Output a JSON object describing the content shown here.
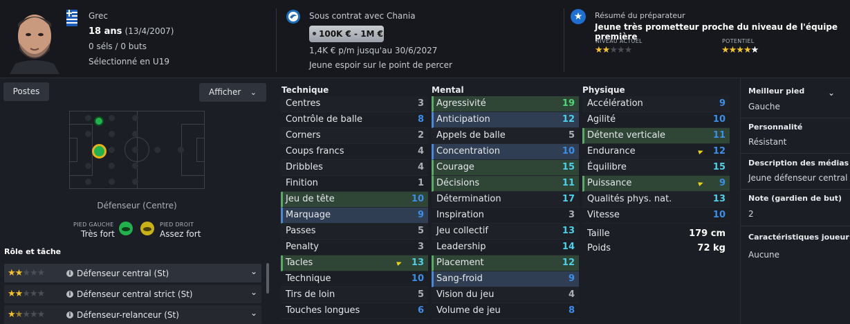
{
  "header": {
    "nationality": "Grec",
    "age": "18 ans",
    "birthdate": "(13/4/2007)",
    "caps": "0 séls / 0 buts",
    "selection": "Sélectionné en U19",
    "contract": "Sous contrat avec Chania",
    "value": "100K € - 1M €",
    "wage": "1,4K € p/m jusqu'au 30/6/2027",
    "status": "Jeune espoir sur le point de percer",
    "scout_title": "Résumé du préparateur",
    "scout_summary": "Jeune très prometteur proche du niveau de l'équipe première",
    "current_label": "NIVEAU ACTUEL",
    "potential_label": "POTENTIEL",
    "current_stars": 2,
    "potential_stars": 4.5
  },
  "left": {
    "postes_button": "Postes",
    "afficher_button": "Afficher",
    "position": "Défenseur (Centre)",
    "left_foot_label": "PIED GAUCHE",
    "left_foot_value": "Très fort",
    "right_foot_label": "PIED DROIT",
    "right_foot_value": "Assez fort",
    "roles_title": "Rôle et tâche",
    "roles": [
      {
        "label": "Défenseur central (St)",
        "stars": 2
      },
      {
        "label": "Défenseur central strict (St)",
        "stars": 2
      },
      {
        "label": "Défenseur-relanceur (St)",
        "stars": 1.5
      }
    ]
  },
  "attributes": {
    "technique_title": "Technique",
    "mental_title": "Mental",
    "physique_title": "Physique",
    "technique": [
      {
        "name": "Centres",
        "value": "3"
      },
      {
        "name": "Contrôle de balle",
        "value": "8"
      },
      {
        "name": "Corners",
        "value": "2"
      },
      {
        "name": "Coups francs",
        "value": "4"
      },
      {
        "name": "Dribbles",
        "value": "4"
      },
      {
        "name": "Finition",
        "value": "1"
      },
      {
        "name": "Jeu de tête",
        "value": "10"
      },
      {
        "name": "Marquage",
        "value": "9"
      },
      {
        "name": "Passes",
        "value": "5"
      },
      {
        "name": "Penalty",
        "value": "3"
      },
      {
        "name": "Tacles",
        "value": "13"
      },
      {
        "name": "Technique",
        "value": "10"
      },
      {
        "name": "Tirs de loin",
        "value": "5"
      },
      {
        "name": "Touches longues",
        "value": "6"
      }
    ],
    "mental": [
      {
        "name": "Agressivité",
        "value": "19"
      },
      {
        "name": "Anticipation",
        "value": "12"
      },
      {
        "name": "Appels de balle",
        "value": "5"
      },
      {
        "name": "Concentration",
        "value": "10"
      },
      {
        "name": "Courage",
        "value": "15"
      },
      {
        "name": "Décisions",
        "value": "11"
      },
      {
        "name": "Détermination",
        "value": "17"
      },
      {
        "name": "Inspiration",
        "value": "3"
      },
      {
        "name": "Jeu collectif",
        "value": "13"
      },
      {
        "name": "Leadership",
        "value": "14"
      },
      {
        "name": "Placement",
        "value": "12"
      },
      {
        "name": "Sang-froid",
        "value": "9"
      },
      {
        "name": "Vision du jeu",
        "value": "4"
      },
      {
        "name": "Volume de jeu",
        "value": "8"
      }
    ],
    "physique": [
      {
        "name": "Accélération",
        "value": "9"
      },
      {
        "name": "Agilité",
        "value": "10"
      },
      {
        "name": "Détente verticale",
        "value": "11"
      },
      {
        "name": "Endurance",
        "value": "12"
      },
      {
        "name": "Équilibre",
        "value": "15"
      },
      {
        "name": "Puissance",
        "value": "9"
      },
      {
        "name": "Qualités phys. nat.",
        "value": "13"
      },
      {
        "name": "Vitesse",
        "value": "10"
      }
    ],
    "height_label": "Taille",
    "height_value": "179 cm",
    "weight_label": "Poids",
    "weight_value": "72 kg"
  },
  "right": {
    "foot_title": "Meilleur pied",
    "foot_value": "Gauche",
    "personality_title": "Personnalité",
    "personality_value": "Résistant",
    "media_title": "Description des médias",
    "media_value": "Jeune défenseur central",
    "gk_title": "Note (gardien de but)",
    "gk_value": "2",
    "traits_title": "Caractéristiques joueur",
    "traits_value": "Aucune"
  },
  "colors": {
    "background": "#1b1e24",
    "highlight_green": "#2f4535",
    "highlight_blue": "#2f3e52",
    "star": "#f2c230",
    "value_blue": "#3d8ee8",
    "value_cyan": "#4fd0e8",
    "value_green": "#52d67a"
  }
}
